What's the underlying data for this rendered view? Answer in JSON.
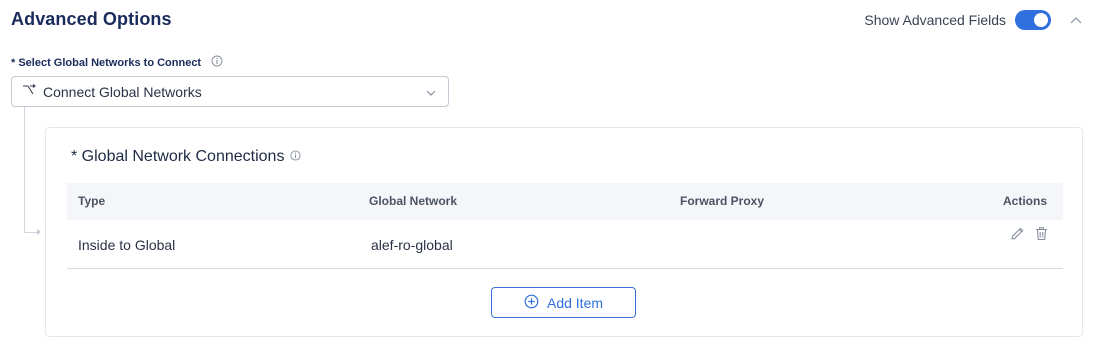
{
  "section": {
    "title": "Advanced Options",
    "toggle_label": "Show Advanced Fields",
    "toggle_on": true,
    "accent_color": "#2f6fde"
  },
  "network_select": {
    "label": "* Select Global Networks to Connect",
    "value": "Connect Global Networks",
    "icon": "branch-icon"
  },
  "connections": {
    "title": "* Global Network Connections",
    "columns": [
      "Type",
      "Global Network",
      "Forward Proxy",
      "Actions"
    ],
    "rows": [
      {
        "type": "Inside to Global",
        "global_network": "alef-ro-global",
        "forward_proxy": ""
      }
    ],
    "add_button_label": "Add Item"
  }
}
